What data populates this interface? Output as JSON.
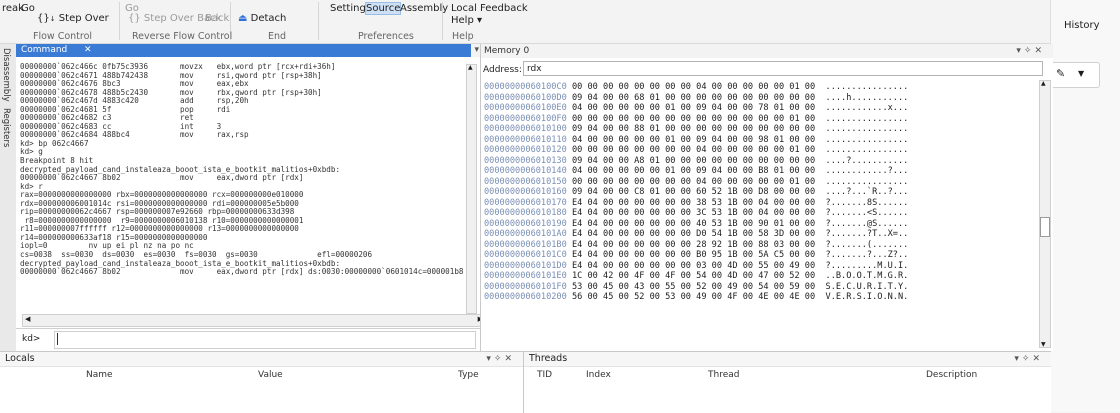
{
  "ribbon": {
    "break": "reak",
    "go": "Go",
    "step_over": "Step Over",
    "go_back": "Go",
    "step_over_back": "Step Over Back",
    "back": "Back",
    "detach": "Detach",
    "settings": "Settings",
    "source": "Source",
    "assembly": "Assembly",
    "local_help": "Local",
    "help_menu": "Help",
    "feedback": "Feedback",
    "groups": {
      "flow_control": "Flow Control",
      "reverse_flow_control": "Reverse Flow Control",
      "end": "End",
      "preferences": "Preferences",
      "help": "Help"
    }
  },
  "right_panel": {
    "history": "History"
  },
  "side_tabs": {
    "disassembly": "Disassembly",
    "registers": "Registers"
  },
  "command": {
    "title": "Command",
    "lines": [
      "00000000`062c466c 0fb75c3936       movzx   ebx,word ptr [rcx+rdi+36h]",
      "00000000`062c4671 488b742438       mov     rsi,qword ptr [rsp+38h]",
      "00000000`062c4676 8bc3             mov     eax,ebx",
      "00000000`062c4678 488b5c2430       mov     rbx,qword ptr [rsp+30h]",
      "00000000`062c467d 4883c420         add     rsp,20h",
      "00000000`062c4681 5f               pop     rdi",
      "00000000`062c4682 c3               ret",
      "00000000`062c4683 cc               int     3",
      "00000000`062c4684 488bc4           mov     rax,rsp",
      "kd> bp 062c4667",
      "kd> g",
      "Breakpoint 8 hit",
      "decrypted_payload_cand_instaleaza_booot_ista_e_bootkit_malitios+0xbdb:",
      "00000000`062c4667 8b02             mov     eax,dword ptr [rdx]",
      "kd> r",
      "rax=0000000000000000 rbx=0000000000000000 rcx=000000000e010000",
      "rdx=000000006001014c rsi=0000000000000000 rdi=000000005e5b000",
      "rip=00000000062c4667 rsp=000000007e92660 rbp=00000000633d398",
      " r8=0000000000000000  r9=0000000006010138 r10=0000000000000001",
      "r11=000000007ffffff r12=0000000000000000 r13=0000000000000000",
      "r14=000000000633af18 r15=0000000000000000",
      "iopl=0         nv up ei pl nz na po nc",
      "cs=0038  ss=0030  ds=0030  es=0030  fs=0030  gs=0030             efl=00000206",
      "decrypted_payload_cand_instaleaza_booot_ista_e_bootkit_malitios+0xbdb:",
      "00000000`062c4667 8b02             mov     eax,dword ptr [rdx] ds:0030:00000000`0601014c=000001b8"
    ],
    "prompt": "kd>"
  },
  "memory": {
    "title": "Memory 0",
    "address_label": "Address:",
    "address_value": "rdx",
    "rows": [
      {
        "addr": "00000000060100C0",
        "bytes": "00 00 00 00 00 00 00 00 04 00 00 00 00 00 01 00",
        "ascii": "................"
      },
      {
        "addr": "00000000060100D0",
        "bytes": "09 04 00 00 68 01 00 00 00 00 00 00 00 00 00 00",
        "ascii": "....h..........."
      },
      {
        "addr": "00000000060100E0",
        "bytes": "04 00 00 00 00 00 01 00 09 04 00 00 78 01 00 00",
        "ascii": "............x..."
      },
      {
        "addr": "00000000060100F0",
        "bytes": "00 00 00 00 00 00 00 00 00 00 00 00 00 00 01 00",
        "ascii": "................"
      },
      {
        "addr": "0000000006010100",
        "bytes": "09 04 00 00 88 01 00 00 00 00 00 00 00 00 00 00",
        "ascii": "................"
      },
      {
        "addr": "0000000006010110",
        "bytes": "04 00 00 00 00 00 01 00 09 04 00 00 98 01 00 00",
        "ascii": "................"
      },
      {
        "addr": "0000000006010120",
        "bytes": "00 00 00 00 00 00 00 00 04 00 00 00 00 00 01 00",
        "ascii": "................"
      },
      {
        "addr": "0000000006010130",
        "bytes": "09 04 00 00 A8 01 00 00 00 00 00 00 00 00 00 00",
        "ascii": "....?..........."
      },
      {
        "addr": "0000000006010140",
        "bytes": "04 00 00 00 00 00 01 00 09 04 00 00 B8 01 00 00",
        "ascii": "............?..."
      },
      {
        "addr": "0000000006010150",
        "bytes": "00 00 00 00 00 00 00 00 04 00 00 00 00 00 01 00",
        "ascii": "................"
      },
      {
        "addr": "0000000006010160",
        "bytes": "09 04 00 00 C8 01 00 00 60 52 1B 00 D8 00 00 00",
        "ascii": "....?...`R..?..."
      },
      {
        "addr": "0000000006010170",
        "bytes": "E4 04 00 00 00 00 00 00 38 53 1B 00 04 00 00 00",
        "ascii": "?.......8S......"
      },
      {
        "addr": "0000000006010180",
        "bytes": "E4 04 00 00 00 00 00 00 3C 53 1B 00 04 00 00 00",
        "ascii": "?.......<S......"
      },
      {
        "addr": "0000000006010190",
        "bytes": "E4 04 00 00 00 00 00 00 40 53 1B 00 90 01 00 00",
        "ascii": "?.......@S......"
      },
      {
        "addr": "00000000060101A0",
        "bytes": "E4 04 00 00 00 00 00 00 D0 54 1B 00 58 3D 00 00",
        "ascii": "?.......?T..X=.."
      },
      {
        "addr": "00000000060101B0",
        "bytes": "E4 04 00 00 00 00 00 00 28 92 1B 00 88 03 00 00",
        "ascii": "?.......(......."
      },
      {
        "addr": "00000000060101C0",
        "bytes": "E4 04 00 00 00 00 00 00 B0 95 1B 00 5A C5 00 00",
        "ascii": "?.......?...Z?.."
      },
      {
        "addr": "00000000060101D0",
        "bytes": "E4 04 00 00 00 00 00 00 03 00 4D 00 55 00 49 00",
        "ascii": "?.........M.U.I."
      },
      {
        "addr": "00000000060101E0",
        "bytes": "1C 00 42 00 4F 00 4F 00 54 00 4D 00 47 00 52 00",
        "ascii": "..B.O.O.T.M.G.R."
      },
      {
        "addr": "00000000060101F0",
        "bytes": "53 00 45 00 43 00 55 00 52 00 49 00 54 00 59 00",
        "ascii": "S.E.C.U.R.I.T.Y."
      },
      {
        "addr": "0000000006010200",
        "bytes": "56 00 45 00 52 00 53 00 49 00 4F 00 4E 00 4E 00",
        "ascii": "V.E.R.S.I.O.N.N."
      }
    ]
  },
  "locals": {
    "title": "Locals",
    "columns": [
      "Name",
      "Value",
      "Type"
    ]
  },
  "threads": {
    "title": "Threads",
    "columns": [
      "TID",
      "Index",
      "Thread",
      "Description"
    ]
  },
  "colors": {
    "accent": "#3a7bd5",
    "address": "#7a8fb5"
  }
}
